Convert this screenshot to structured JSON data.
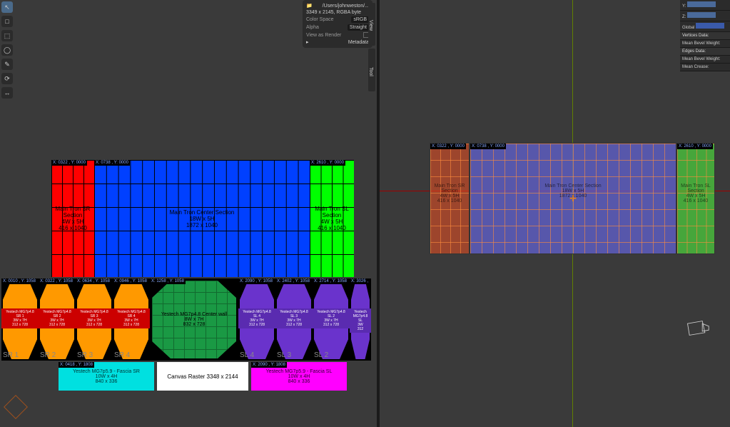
{
  "file_info": {
    "path": "/Users/johnweston/...",
    "dimensions": "3349 x 2145, RGBA byte",
    "color_space_label": "Color Space",
    "color_space_value": "sRGB",
    "alpha_label": "Alpha",
    "alpha_value": "Straight",
    "view_render_label": "View as Render",
    "metadata_label": "Metadata"
  },
  "sidebar_toggle_left": "View",
  "sidebar_toggle_left2": "Tool",
  "properties": {
    "y_label": "Y:",
    "z_label": "Z:",
    "global_label": "Global",
    "verts_header": "Vertices Data:",
    "verts_bevel": "Mean Bevel Weight:",
    "edges_header": "Edges Data:",
    "edges_bevel": "Mean Bevel Weight:",
    "mean_crease": "Mean Crease:"
  },
  "coords": {
    "tron_sr": "X: 0322 , Y: 0000",
    "tron_center": "X: 0738 , Y: 0000",
    "tron_sl": "X: 2610 , Y: 0000",
    "yestech_sr1": "X: 0010 , Y: 1058",
    "yestech_sr2": "X: 0322 , Y: 1058",
    "yestech_sr3": "X: 0634 , Y: 1058",
    "yestech_sr4": "X: 0946 , Y: 1058",
    "center_wall": "X: 1258 , Y: 1058",
    "yestech_sl4": "X: 2090 , Y: 1058",
    "yestech_sl3": "X: 2402 , Y: 1058",
    "yestech_sl2": "X: 2714 , Y: 1058",
    "yestech_sl1": "X: 3026 ,",
    "fascia_sr": "X: 0418 , Y: 1808",
    "fascia_sl": "X: 2090 , Y: 1808",
    "uv_sr": "X: 0322 , Y: 0000",
    "uv_center": "X: 0738 , Y: 0000",
    "uv_sl": "X: 2610 , Y: 0000"
  },
  "tron": {
    "sr": {
      "title": "Main Tron SR Section",
      "dims": "4W x 5H",
      "px": "416 x 1040"
    },
    "center": {
      "title": "Main Tron Center Section",
      "dims": "18W x 5H",
      "px": "1872 x 1040"
    },
    "sl": {
      "title": "Main Tron SL Section",
      "dims": "4W x 5H",
      "px": "416 x 1040"
    }
  },
  "yestech_sr": [
    {
      "name": "Yestech MG7p4.8",
      "id": "SR 1",
      "dims": "3W x 7H",
      "px": "312 x 728",
      "label": "SR 1"
    },
    {
      "name": "Yestech MG7p4.8",
      "id": "SR 2",
      "dims": "3W x 7H",
      "px": "312 x 728",
      "label": "SR 2"
    },
    {
      "name": "Yestech MG7p4.8",
      "id": "SR 3",
      "dims": "3W x 7H",
      "px": "312 x 728",
      "label": "SR 3"
    },
    {
      "name": "Yestech MG7p4.8",
      "id": "SR 4",
      "dims": "3W x 7H",
      "px": "312 x 728",
      "label": "SR 4"
    }
  ],
  "center_wall": {
    "name": "Yestech MG7p4.8 Center wall",
    "dims": "8W x 7H",
    "px": "832 x 728"
  },
  "yestech_sl": [
    {
      "name": "Yestech MG7p4.8",
      "id": "SL 4",
      "dims": "3W x 7H",
      "px": "312 x 728",
      "label": "SL 4"
    },
    {
      "name": "Yestech MG7p4.8",
      "id": "SL 3",
      "dims": "3W x 7H",
      "px": "312 x 728",
      "label": "SL 3"
    },
    {
      "name": "Yestech MG7p4.8",
      "id": "SL 2",
      "dims": "3W x 7H",
      "px": "312 x 728",
      "label": "SL 2"
    },
    {
      "name": "Yestech MG7p4.8",
      "id": "SL",
      "dims": "3W",
      "px": "312",
      "label": ""
    }
  ],
  "fascia": {
    "sr": {
      "name": "Yestech MG7p5.9 - Fascia SR",
      "dims": "10W x 4H",
      "px": "840 x 336"
    },
    "raster": "Canvas Raster 3348 x 2144",
    "sl": {
      "name": "Yestech MG7p5.9 - Fascia SL",
      "dims": "10W x 4H",
      "px": "840 x 336"
    }
  },
  "tool_icons_left": [
    "↖",
    "□",
    "⬚",
    "◯",
    "✎",
    "⟳",
    "↔"
  ],
  "tool_icons_right": [
    "↖",
    "□",
    "⬚",
    "◯",
    "✎",
    "⟳",
    "↔",
    "",
    "▭",
    "▢",
    "▣",
    "⬡",
    "⬢",
    "○",
    "△",
    "▲",
    "◆",
    "◇",
    "●",
    "✦",
    "⬚",
    "❐"
  ]
}
